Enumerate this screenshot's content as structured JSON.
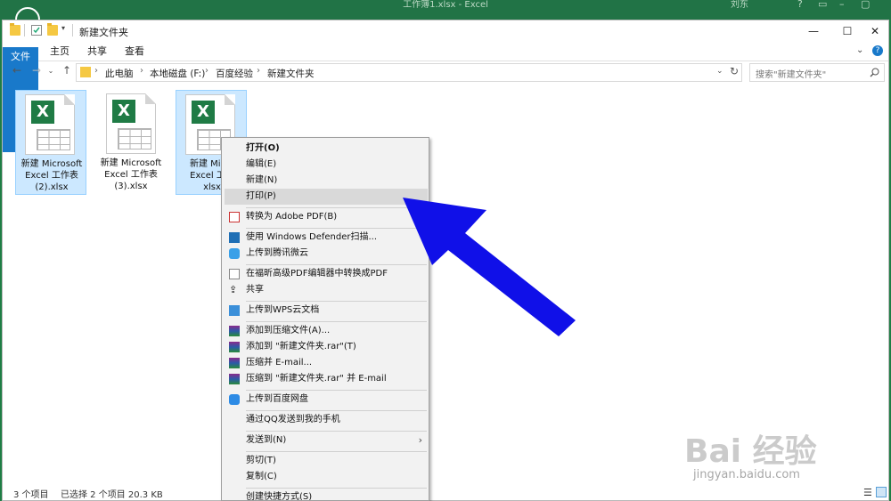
{
  "background_window": {
    "title": "工作簿1.xlsx  -  Excel",
    "user": "刘东"
  },
  "window": {
    "title": "新建文件夹",
    "minimize": "—",
    "maximize": "☐",
    "close": "✕"
  },
  "ribbon": {
    "tabs": [
      "文件",
      "主页",
      "共享",
      "查看"
    ]
  },
  "address": {
    "crumbs": [
      "此电脑",
      "本地磁盘 (F:)",
      "百度经验",
      "新建文件夹"
    ],
    "search_placeholder": "搜索\"新建文件夹\""
  },
  "files": [
    {
      "name": "新建 Microsoft Excel 工作表 (2).xlsx",
      "line1": "新建 Microsoft",
      "line2": "Excel 工作表",
      "line3": "(2).xlsx",
      "selected": true
    },
    {
      "name": "新建 Microsoft Excel 工作表 (3).xlsx",
      "line1": "新建 Microsoft",
      "line2": "Excel 工作表",
      "line3": "(3).xlsx",
      "selected": false
    },
    {
      "name": "新建 Microsoft Excel 工作表.xlsx",
      "line1": "新建 Micro",
      "line2": "Excel 工作",
      "line3": "xlsx",
      "selected": true
    }
  ],
  "status": {
    "count": "3 个项目",
    "selected": "已选择 2 个项目  20.3 KB"
  },
  "context_menu": {
    "open": "打开(O)",
    "edit": "编辑(E)",
    "new": "新建(N)",
    "print": "打印(P)",
    "convert_pdf": "转换为 Adobe PDF(B)",
    "defender": "使用 Windows Defender扫描...",
    "tencent_cloud": "上传到腾讯微云",
    "foxit": "在福昕高级PDF编辑器中转换成PDF",
    "share": "共享",
    "wps": "上传到WPS云文档",
    "add_archive": "添加到压缩文件(A)...",
    "add_rar": "添加到 \"新建文件夹.rar\"(T)",
    "zip_email": "压缩并 E-mail...",
    "rar_email": "压缩到 \"新建文件夹.rar\" 并 E-mail",
    "baidu": "上传到百度网盘",
    "qq": "通过QQ发送到我的手机",
    "send_to": "发送到(N)",
    "cut": "剪切(T)",
    "copy": "复制(C)",
    "shortcut": "创建快捷方式(S)"
  },
  "watermark": {
    "brand": "Bai 经验",
    "url": "jingyan.baidu.com"
  },
  "colors": {
    "excel_green": "#1f7b45",
    "file_tab": "#1979ca",
    "selection": "#cce8ff",
    "arrow": "#1010e8"
  }
}
